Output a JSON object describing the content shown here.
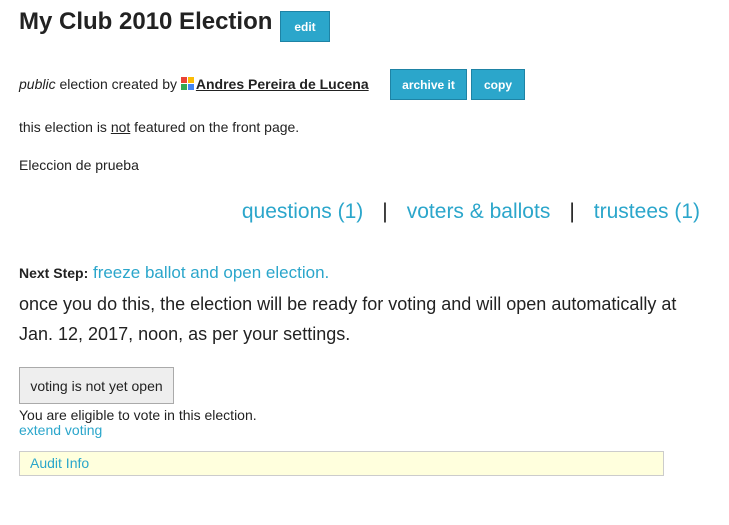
{
  "election": {
    "title": "My Club 2010 Election",
    "edit_label": "edit",
    "visibility": "public",
    "created_by_text": " election created by ",
    "creator_name": "Andres Pereira de Lucena",
    "creator_icon": "google-icon",
    "archive_label": "archive it",
    "copy_label": "copy",
    "featured_prefix": "this election is ",
    "featured_not": "not",
    "featured_suffix": " featured on the front page.",
    "description": "Eleccion de prueba"
  },
  "nav": {
    "questions": "questions (1)",
    "separator": "|",
    "voters": "voters & ballots",
    "trustees": "trustees (1)"
  },
  "next_step": {
    "label": "Next Step:",
    "link": "freeze ballot and open election.",
    "explanation": "once you do this, the election will be ready for voting and will open automatically at Jan. 12, 2017, noon, as per your settings."
  },
  "voting": {
    "status": "voting is not yet open",
    "eligible": "You are eligible to vote in this election.",
    "extend": "extend voting"
  },
  "audit": {
    "label": "Audit Info"
  },
  "colors": {
    "accent": "#2ba6cb",
    "audit_bg": "#ffffdd"
  }
}
